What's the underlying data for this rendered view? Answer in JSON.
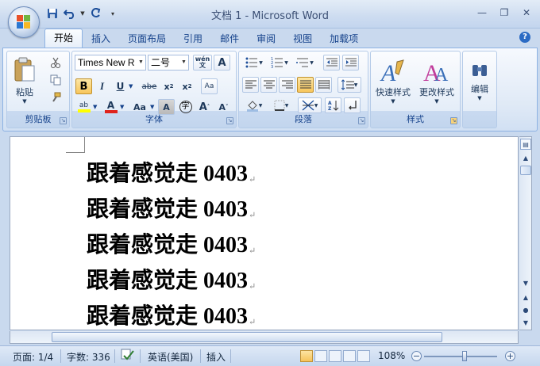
{
  "window": {
    "title": "文档 1 - Microsoft Word"
  },
  "tabs": [
    "开始",
    "插入",
    "页面布局",
    "引用",
    "邮件",
    "审阅",
    "视图",
    "加载项"
  ],
  "active_tab": "开始",
  "ribbon": {
    "clipboard": {
      "label": "剪贴板",
      "paste": "粘贴"
    },
    "font": {
      "label": "字体",
      "font_name": "Times New R",
      "font_size": "二号",
      "wen": "wén\n文"
    },
    "paragraph": {
      "label": "段落"
    },
    "styles": {
      "label": "样式",
      "quick_styles": "快速样式",
      "change_styles": "更改样式"
    },
    "editing": {
      "label": "编辑"
    }
  },
  "document": {
    "lines": [
      {
        "cjk": "跟着感觉走 ",
        "num": "0403"
      },
      {
        "cjk": "跟着感觉走 ",
        "num": "0403"
      },
      {
        "cjk": "跟着感觉走 ",
        "num": "0403"
      },
      {
        "cjk": "跟着感觉走 ",
        "num": "0403"
      },
      {
        "cjk": "跟着感觉走 ",
        "num": "0403"
      }
    ],
    "paragraph_mark": "↵"
  },
  "statusbar": {
    "page": "页面: 1/4",
    "words": "字数: 336",
    "language": "英语(美国)",
    "mode": "插入",
    "zoom": "108%"
  }
}
